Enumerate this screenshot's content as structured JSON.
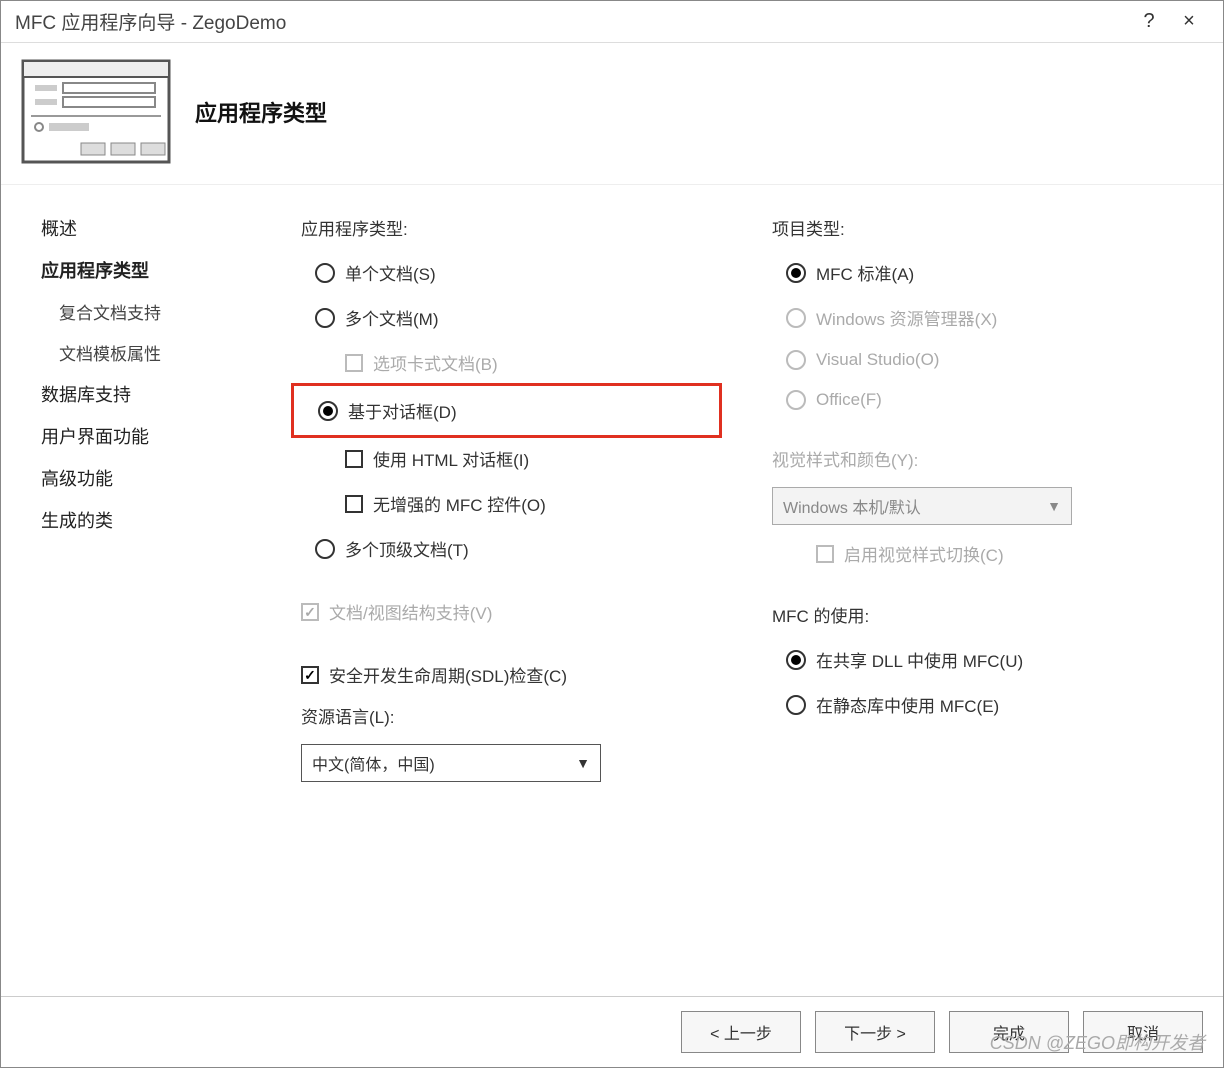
{
  "titlebar": {
    "title": "MFC 应用程序向导 - ZegoDemo",
    "help": "?",
    "close": "×"
  },
  "header": {
    "title": "应用程序类型"
  },
  "sidebar": {
    "overview": "概述",
    "app_type": "应用程序类型",
    "compound_doc": "复合文档支持",
    "doc_template": "文档模板属性",
    "db_support": "数据库支持",
    "ui_features": "用户界面功能",
    "advanced": "高级功能",
    "gen_classes": "生成的类"
  },
  "app_type": {
    "label": "应用程序类型:",
    "single_doc": "单个文档(S)",
    "multi_doc": "多个文档(M)",
    "tabbed_doc": "选项卡式文档(B)",
    "dialog_based": "基于对话框(D)",
    "use_html": "使用 HTML 对话框(I)",
    "no_enhanced": "无增强的 MFC 控件(O)",
    "multi_top": "多个顶级文档(T)",
    "doc_view": "文档/视图结构支持(V)",
    "sdl_check": "安全开发生命周期(SDL)检查(C)",
    "res_lang_label": "资源语言(L):",
    "res_lang_value": "中文(简体，中国)"
  },
  "project_type": {
    "label": "项目类型:",
    "mfc_standard": "MFC 标准(A)",
    "win_explorer": "Windows 资源管理器(X)",
    "visual_studio": "Visual Studio(O)",
    "office": "Office(F)"
  },
  "visual_style": {
    "label": "视觉样式和颜色(Y):",
    "value": "Windows 本机/默认",
    "enable_switch": "启用视觉样式切换(C)"
  },
  "mfc_usage": {
    "label": "MFC 的使用:",
    "shared_dll": "在共享 DLL 中使用 MFC(U)",
    "static_lib": "在静态库中使用 MFC(E)"
  },
  "footer": {
    "prev": "< 上一步",
    "next": "下一步 >",
    "finish": "完成",
    "cancel": "取消"
  },
  "watermark": "CSDN @ZEGO即构开发者"
}
